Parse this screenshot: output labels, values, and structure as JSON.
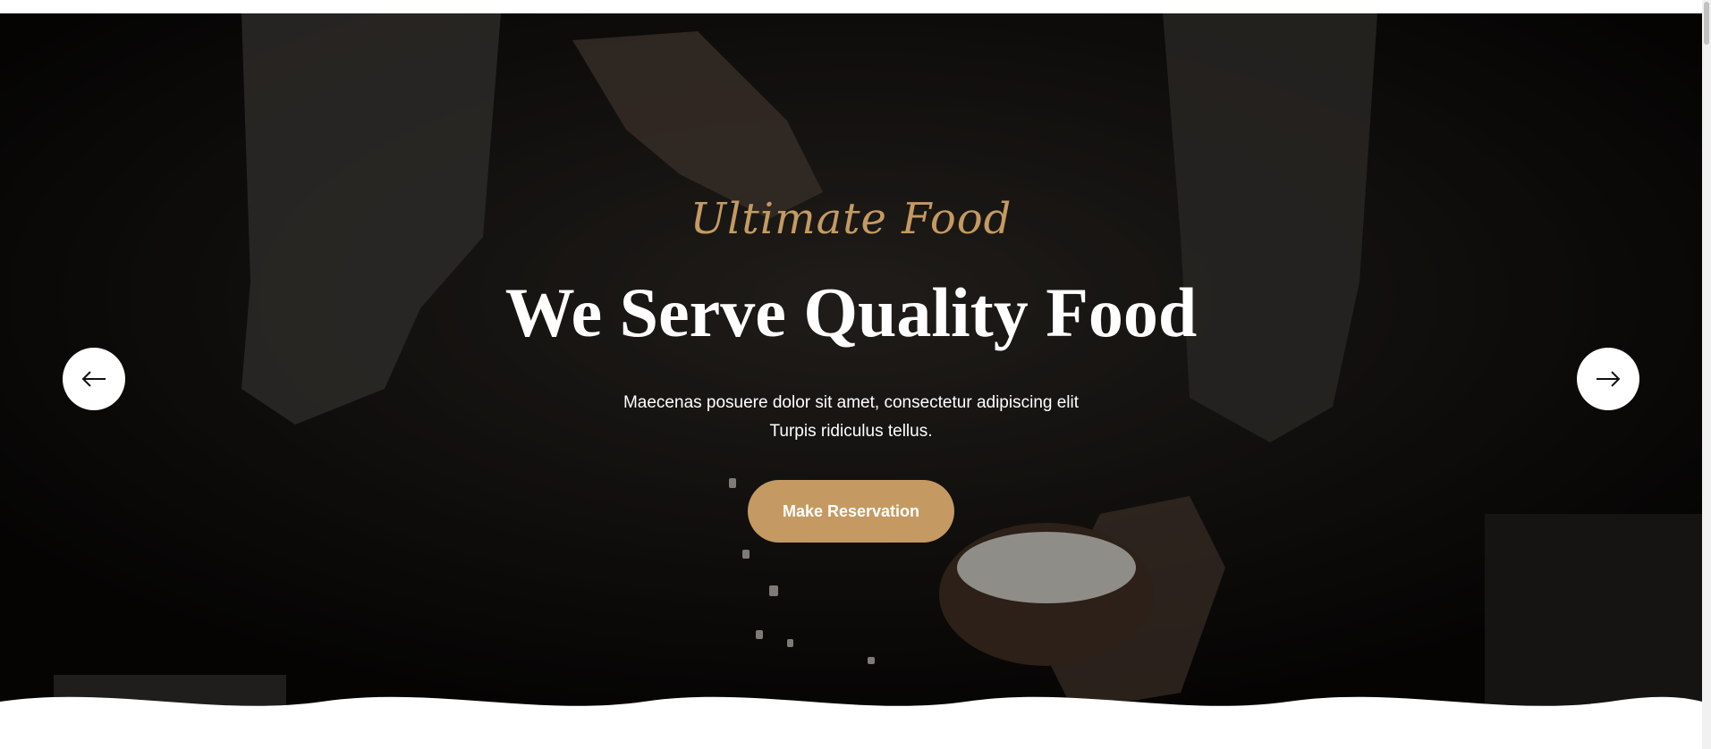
{
  "hero": {
    "eyebrow": "Ultimate Food",
    "headline": "We Serve Quality Food",
    "subtext_line1": "Maecenas posuere dolor sit amet, consectetur adipiscing elit",
    "subtext_line2": "Turpis ridiculus tellus.",
    "cta_label": "Make Reservation",
    "prev_icon": "arrow-left-icon",
    "next_icon": "arrow-right-icon",
    "background_image": "chef sprinkling salt over a coconut bowl"
  },
  "colors": {
    "accent": "#c49a62",
    "background": "#080706",
    "text": "#ffffff"
  }
}
